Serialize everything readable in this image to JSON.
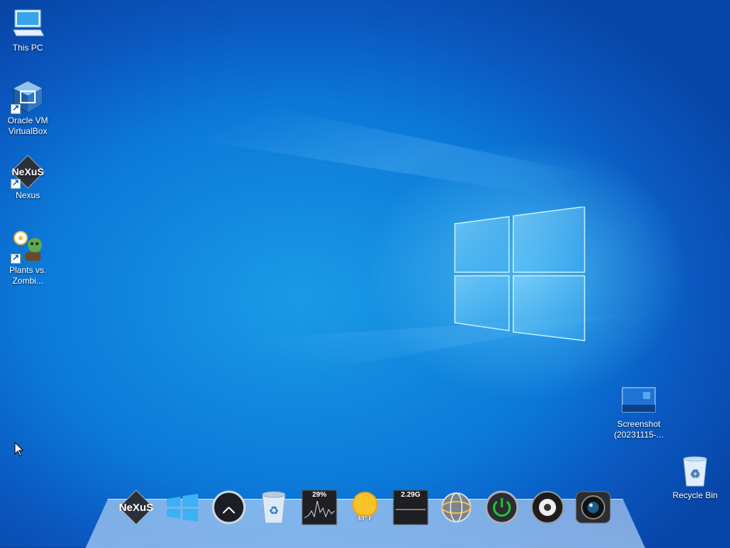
{
  "desktop": {
    "icons_left": [
      {
        "label_lines": [
          "This PC"
        ],
        "icon": "this-pc-icon"
      },
      {
        "label_lines": [
          "Oracle VM",
          "VirtualBox"
        ],
        "icon": "virtualbox-icon"
      },
      {
        "label_lines": [
          "Nexus"
        ],
        "icon": "nexus-icon"
      },
      {
        "label_lines": [
          "Plants vs.",
          "Zombi..."
        ],
        "icon": "plants-vs-zombies-icon"
      }
    ],
    "icons_right": [
      {
        "label_lines": [
          "Screenshot",
          "(20231115-..."
        ],
        "icon": "screenshot-file-icon"
      },
      {
        "label_lines": [
          "Recycle Bin"
        ],
        "icon": "recycle-bin-icon"
      }
    ]
  },
  "dock": {
    "items": [
      {
        "name": "nexus-dock-icon"
      },
      {
        "name": "windows-start-icon"
      },
      {
        "name": "clock-icon"
      },
      {
        "name": "recycle-bin-dock-icon"
      },
      {
        "name": "cpu-meter-icon",
        "value": "29%"
      },
      {
        "name": "weather-icon",
        "value": "49° F"
      },
      {
        "name": "memory-meter-icon",
        "value": "2.29G"
      },
      {
        "name": "network-globe-icon"
      },
      {
        "name": "power-button-icon"
      },
      {
        "name": "speaker-icon"
      },
      {
        "name": "camera-icon"
      }
    ]
  },
  "colors": {
    "wallpaper_base": "#0b78d8",
    "logo_glow": "#7fd3ff",
    "power_green": "#22c43a"
  }
}
